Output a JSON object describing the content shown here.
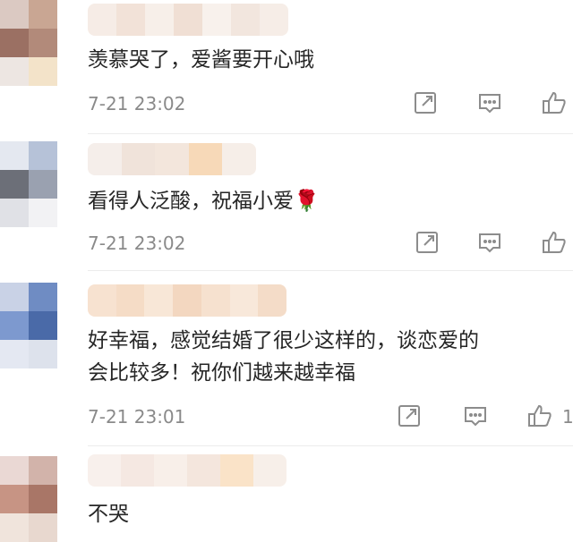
{
  "comments": [
    {
      "text": "羡慕哭了，爱酱要开心哦",
      "time": "7-21 23:02",
      "like_count": "",
      "icons": [
        "share-icon",
        "comment-icon",
        "thumbs-up-icon"
      ]
    },
    {
      "text": "看得人泛酸，祝福小爱🌹",
      "time": "7-21 23:02",
      "like_count": "",
      "icons": [
        "share-icon",
        "comment-icon",
        "thumbs-up-icon"
      ]
    },
    {
      "text_line1": "好幸福，感觉结婚了很少这样的，谈恋爱的",
      "text_line2": "会比较多！祝你们越来越幸福",
      "time": "7-21 23:01",
      "like_count": "1",
      "icons": [
        "share-icon",
        "comment-icon",
        "thumbs-up-icon"
      ]
    },
    {
      "text": "不哭",
      "icons": []
    }
  ],
  "colors": {
    "text": "#262626",
    "meta": "#8a8a8a",
    "icon": "#8c8c8c",
    "divider": "#ececec"
  }
}
